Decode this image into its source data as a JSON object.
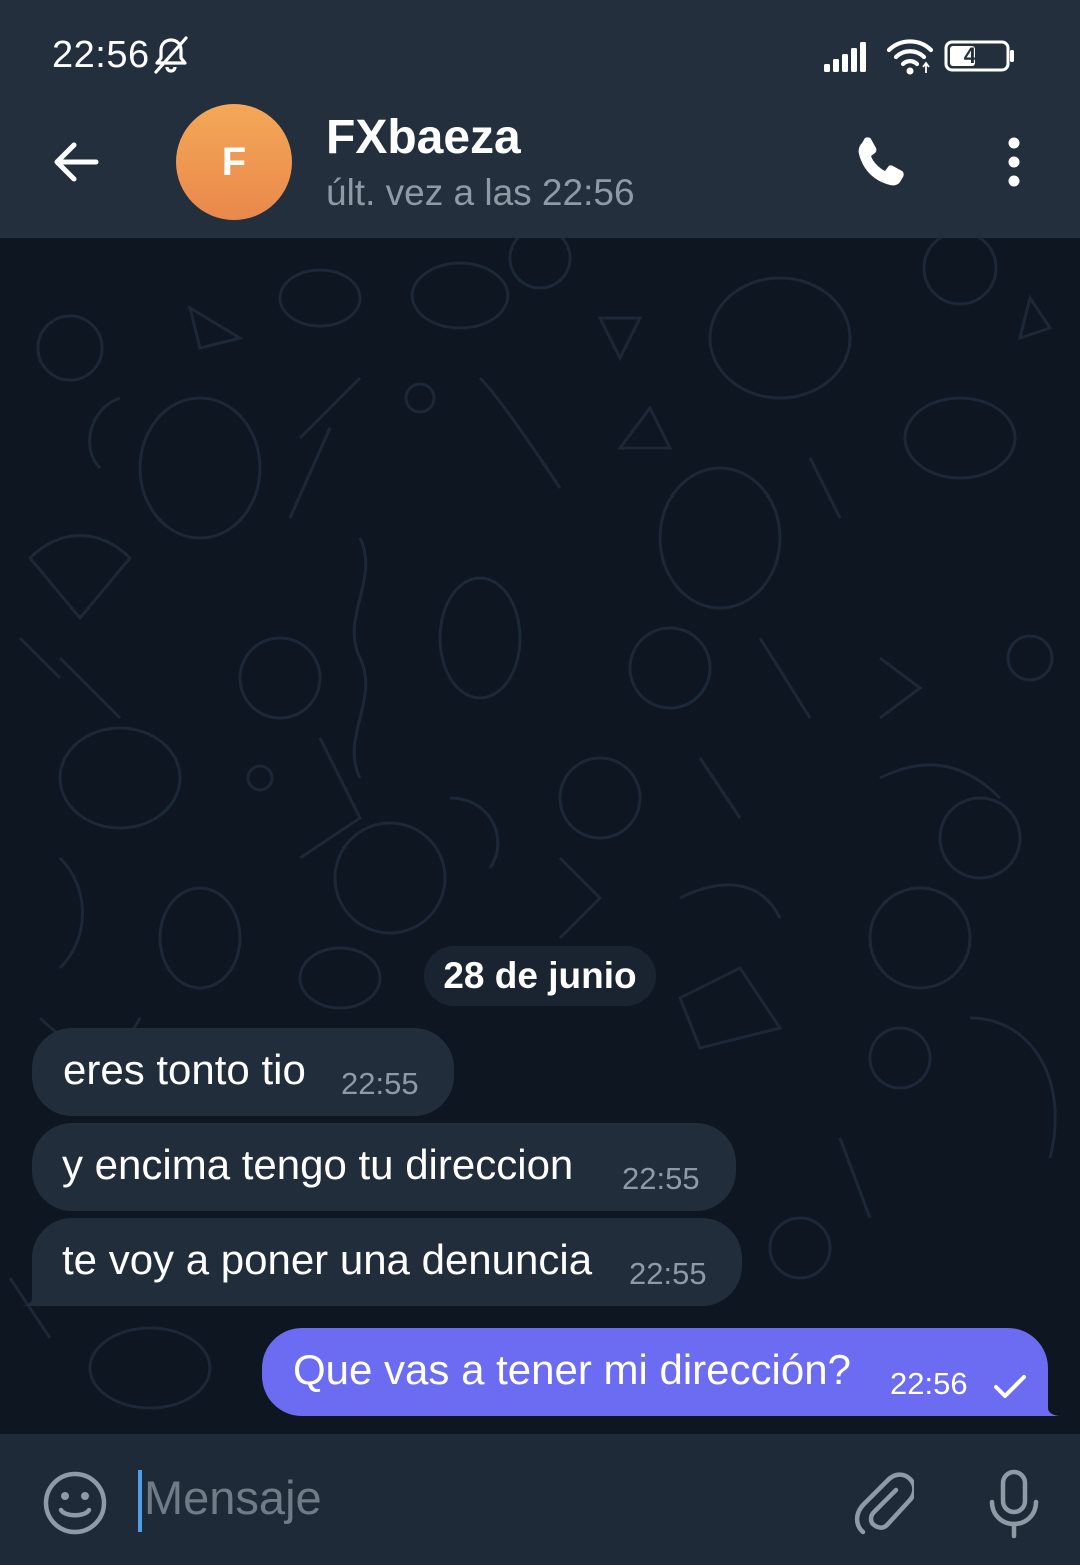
{
  "status_bar": {
    "time": "22:56",
    "battery_level": "44",
    "icons": [
      "bell-muted-icon",
      "signal-icon",
      "wifi-icon",
      "battery-icon"
    ]
  },
  "header": {
    "avatar_initial": "F",
    "contact_name": "FXbaeza",
    "last_seen": "últ. vez a las 22:56",
    "icons": [
      "back-arrow-icon",
      "phone-icon",
      "more-vertical-icon"
    ]
  },
  "chat": {
    "date_separator": "28 de junio",
    "messages": [
      {
        "direction": "incoming",
        "text": "eres tonto tio",
        "time": "22:55"
      },
      {
        "direction": "incoming",
        "text": "y encima tengo tu direccion",
        "time": "22:55"
      },
      {
        "direction": "incoming",
        "text": "te voy a poner una denuncia",
        "time": "22:55"
      },
      {
        "direction": "outgoing",
        "text": "Que vas a tener mi dirección?",
        "time": "22:56",
        "status": "sent-check-icon"
      }
    ]
  },
  "composer": {
    "placeholder": "Mensaje",
    "icons": [
      "emoji-icon",
      "attach-icon",
      "microphone-icon"
    ]
  },
  "colors": {
    "header_bg": "#242f3d",
    "chat_bg": "#0e1621",
    "incoming_bubble": "#212d3b",
    "outgoing_bubble": "#6c6cf2",
    "avatar": "#ee9650",
    "secondary_text": "#8e9aa6",
    "caret": "#4d9fea"
  }
}
